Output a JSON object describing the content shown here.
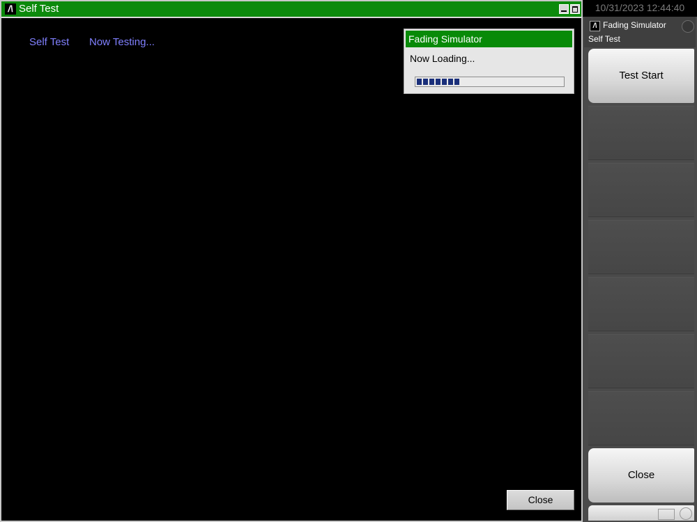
{
  "window": {
    "title": "Self Test",
    "title_bar_color": "#0c8a0c"
  },
  "status": {
    "label": "Self Test",
    "message": "Now Testing..."
  },
  "dialog": {
    "title": "Fading Simulator",
    "message": "Now Loading...",
    "progress_percent": 30
  },
  "main_close_label": "Close",
  "side_panel": {
    "datetime": "10/31/2023 12:44:40",
    "app_name": "Fading Simulator",
    "subtitle": "Self Test",
    "softkeys": [
      {
        "label": "Test Start"
      },
      {
        "label": "Close"
      }
    ]
  },
  "icons": [
    "anritsu-logo-icon",
    "minimize-icon",
    "maximize-icon",
    "status-indicator-icon"
  ]
}
